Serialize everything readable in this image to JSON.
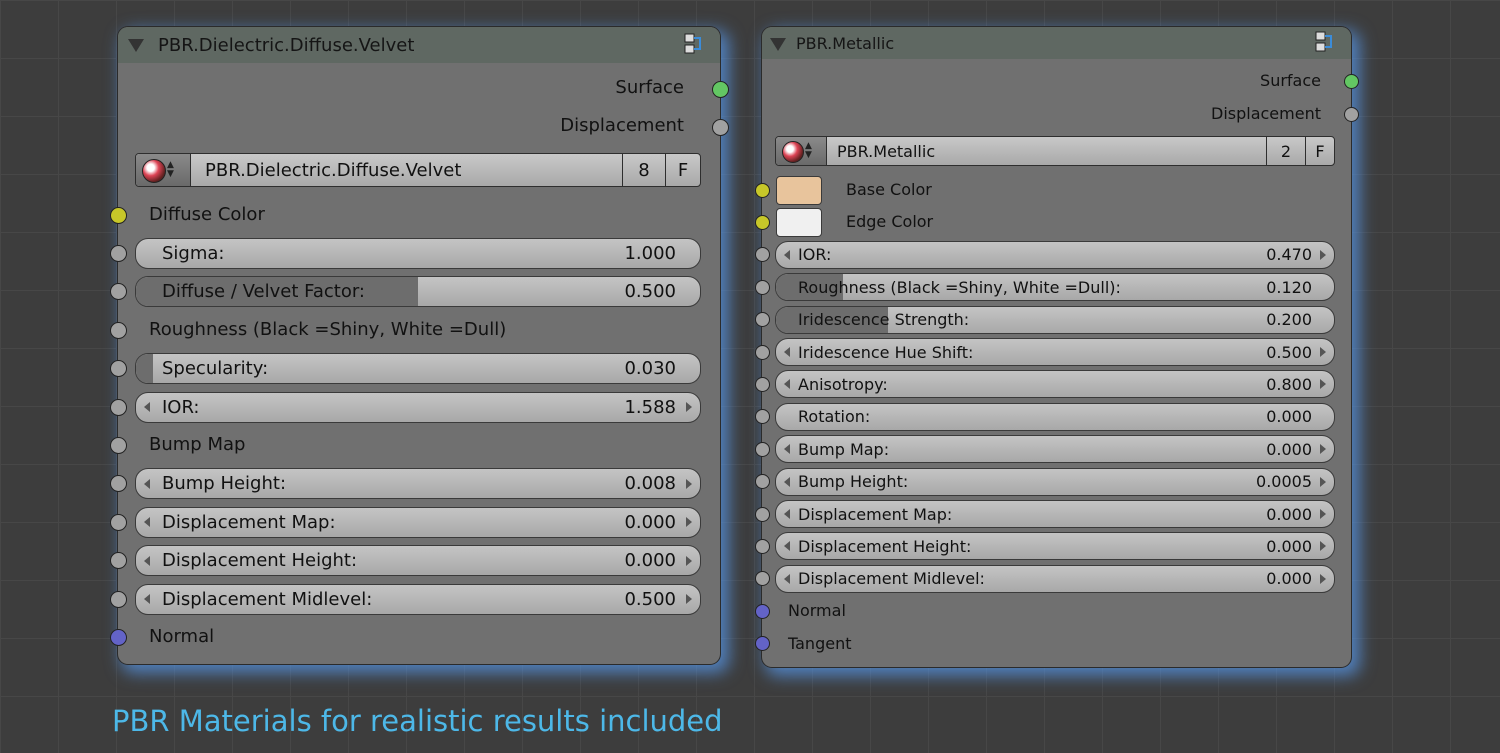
{
  "colors": {
    "accent_glow": "#5694e2",
    "socket_shader": "#63c763",
    "socket_value": "#a1a1a1",
    "socket_color": "#c7c729",
    "socket_vector": "#6363c7",
    "caption": "#4db8e8"
  },
  "caption": "PBR Materials for realistic results included",
  "node1": {
    "title": "PBR.Dielectric.Diffuse.Velvet",
    "outputs": [
      "Surface",
      "Displacement"
    ],
    "selector": {
      "name": "PBR.Dielectric.Diffuse.Velvet",
      "users": "8",
      "fake_user": "F",
      "icon": "material-sphere-icon"
    },
    "inputs": [
      {
        "kind": "label",
        "label": "Diffuse Color",
        "socket": "yellow"
      },
      {
        "kind": "slider",
        "label": "Sigma:",
        "value": "1.000",
        "fill": 0,
        "socket": "gray"
      },
      {
        "kind": "slider",
        "label": "Diffuse / Velvet Factor:",
        "value": "0.500",
        "fill": 0.5,
        "socket": "gray"
      },
      {
        "kind": "label",
        "label": "Roughness (Black =Shiny, White =Dull)",
        "socket": "gray"
      },
      {
        "kind": "slider",
        "label": "Specularity:",
        "value": "0.030",
        "fill": 0.03,
        "socket": "gray"
      },
      {
        "kind": "number",
        "label": "IOR:",
        "value": "1.588",
        "socket": "gray"
      },
      {
        "kind": "label",
        "label": "Bump Map",
        "socket": "gray"
      },
      {
        "kind": "number",
        "label": "Bump Height:",
        "value": "0.008",
        "socket": "gray"
      },
      {
        "kind": "number",
        "label": "Displacement Map:",
        "value": "0.000",
        "socket": "gray"
      },
      {
        "kind": "number",
        "label": "Displacement Height:",
        "value": "0.000",
        "socket": "gray"
      },
      {
        "kind": "number",
        "label": "Displacement Midlevel:",
        "value": "0.500",
        "socket": "gray"
      },
      {
        "kind": "label",
        "label": "Normal",
        "socket": "blue"
      }
    ]
  },
  "node2": {
    "title": "PBR.Metallic",
    "outputs": [
      "Surface",
      "Displacement"
    ],
    "selector": {
      "name": "PBR.Metallic",
      "users": "2",
      "fake_user": "F",
      "icon": "material-sphere-icon"
    },
    "inputs": [
      {
        "kind": "color",
        "label": "Base Color",
        "color": "#e8c49c",
        "socket": "yellow"
      },
      {
        "kind": "color",
        "label": "Edge Color",
        "color": "#f0f0f0",
        "socket": "yellow"
      },
      {
        "kind": "number",
        "label": "IOR:",
        "value": "0.470",
        "socket": "gray"
      },
      {
        "kind": "slider",
        "label": "Roughness (Black =Shiny, White =Dull):",
        "value": "0.120",
        "fill": 0.12,
        "socket": "gray"
      },
      {
        "kind": "slider",
        "label": "Iridescence Strength:",
        "value": "0.200",
        "fill": 0.2,
        "socket": "gray"
      },
      {
        "kind": "number",
        "label": "Iridescence Hue Shift:",
        "value": "0.500",
        "socket": "gray"
      },
      {
        "kind": "number",
        "label": "Anisotropy:",
        "value": "0.800",
        "socket": "gray"
      },
      {
        "kind": "slider",
        "label": "Rotation:",
        "value": "0.000",
        "fill": 0.0,
        "socket": "gray"
      },
      {
        "kind": "number",
        "label": "Bump Map:",
        "value": "0.000",
        "socket": "gray"
      },
      {
        "kind": "number",
        "label": "Bump Height:",
        "value": "0.0005",
        "socket": "gray"
      },
      {
        "kind": "number",
        "label": "Displacement Map:",
        "value": "0.000",
        "socket": "gray"
      },
      {
        "kind": "number",
        "label": "Displacement Height:",
        "value": "0.000",
        "socket": "gray"
      },
      {
        "kind": "number",
        "label": "Displacement Midlevel:",
        "value": "0.000",
        "socket": "gray"
      },
      {
        "kind": "label",
        "label": "Normal",
        "socket": "blue"
      },
      {
        "kind": "label",
        "label": "Tangent",
        "socket": "blue"
      }
    ]
  }
}
